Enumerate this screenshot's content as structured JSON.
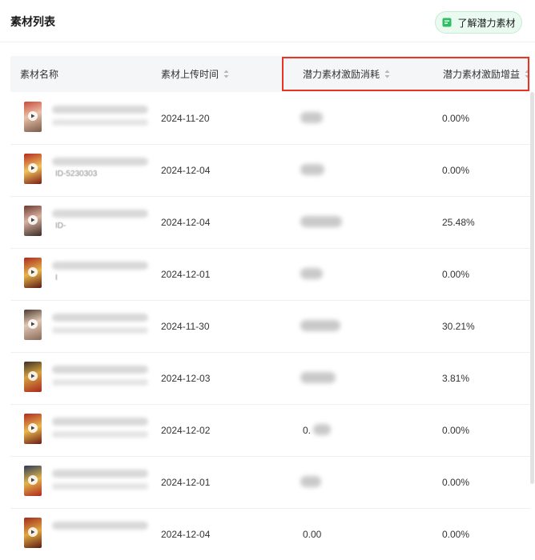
{
  "header": {
    "title": "素材列表",
    "learn_button": "了解潜力素材"
  },
  "table": {
    "columns": [
      "素材名称",
      "素材上传时间",
      "潜力素材激励消耗",
      "潜力素材激励增益"
    ],
    "rows": [
      {
        "date": "2024-11-20",
        "gain": "0.00%",
        "id_prefix": "",
        "cost_visible": ""
      },
      {
        "date": "2024-12-04",
        "gain": "0.00%",
        "id_prefix": "ID-5230303",
        "cost_visible": ""
      },
      {
        "date": "2024-12-04",
        "gain": "25.48%",
        "id_prefix": "ID-",
        "cost_visible": ""
      },
      {
        "date": "2024-12-01",
        "gain": "0.00%",
        "id_prefix": "I",
        "cost_visible": ""
      },
      {
        "date": "2024-11-30",
        "gain": "30.21%",
        "id_prefix": "",
        "cost_visible": ""
      },
      {
        "date": "2024-12-03",
        "gain": "3.81%",
        "id_prefix": "",
        "cost_visible": ""
      },
      {
        "date": "2024-12-02",
        "gain": "0.00%",
        "id_prefix": "",
        "cost_visible": "0."
      },
      {
        "date": "2024-12-01",
        "gain": "0.00%",
        "id_prefix": "",
        "cost_visible": ""
      },
      {
        "date": "2024-12-04",
        "gain": "0.00%",
        "id_prefix": "",
        "cost_visible": "0.00"
      }
    ]
  },
  "colors": {
    "highlight_border": "#ea3323",
    "button_bg": "#eafaf0",
    "header_bg": "#f5f6f8"
  }
}
